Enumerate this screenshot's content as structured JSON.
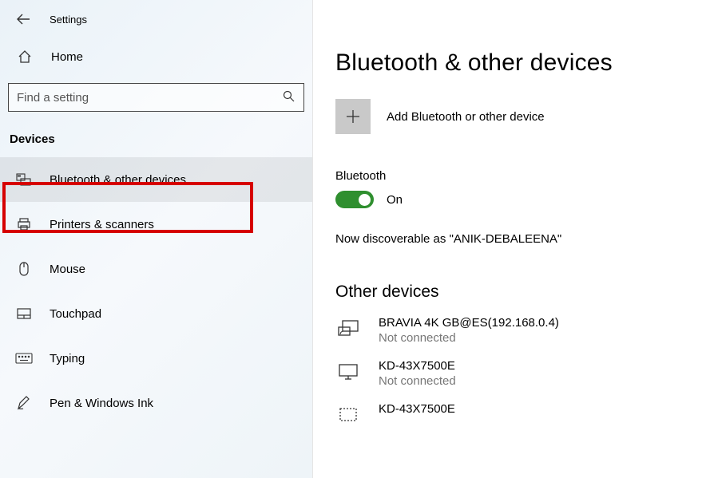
{
  "header": {
    "app_title": "Settings"
  },
  "sidebar": {
    "home_label": "Home",
    "search_placeholder": "Find a setting",
    "category": "Devices",
    "items": [
      {
        "label": "Bluetooth & other devices"
      },
      {
        "label": "Printers & scanners"
      },
      {
        "label": "Mouse"
      },
      {
        "label": "Touchpad"
      },
      {
        "label": "Typing"
      },
      {
        "label": "Pen & Windows Ink"
      }
    ]
  },
  "main": {
    "title": "Bluetooth & other devices",
    "add_label": "Add Bluetooth or other device",
    "bt_section_label": "Bluetooth",
    "toggle_state": "On",
    "discoverable_text": "Now discoverable as \"ANIK-DEBALEENA\"",
    "other_devices_title": "Other devices",
    "devices": [
      {
        "name": "BRAVIA 4K GB@ES(192.168.0.4)",
        "status": "Not connected"
      },
      {
        "name": "KD-43X7500E",
        "status": "Not connected"
      },
      {
        "name": "KD-43X7500E",
        "status": ""
      }
    ]
  }
}
